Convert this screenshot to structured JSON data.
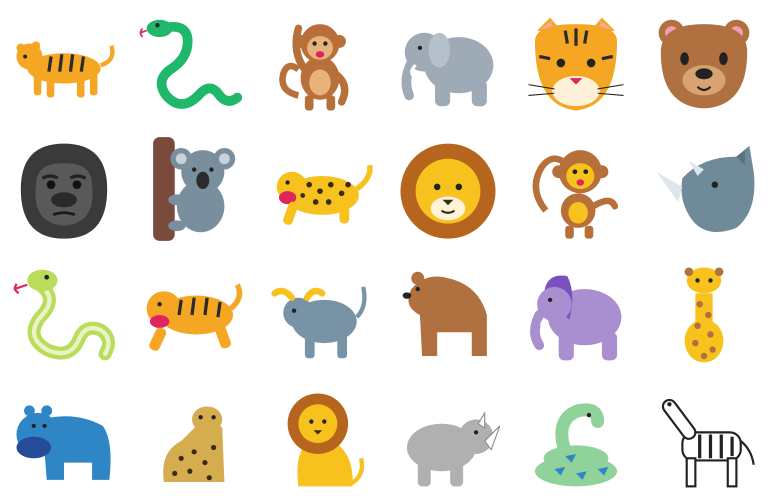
{
  "grid": {
    "rows": 4,
    "columns": 6,
    "cells": [
      {
        "icon": "tiger-walking-icon"
      },
      {
        "icon": "snake-icon"
      },
      {
        "icon": "monkey-icon"
      },
      {
        "icon": "elephant-icon"
      },
      {
        "icon": "tiger-face-icon"
      },
      {
        "icon": "bear-face-icon"
      },
      {
        "icon": "gorilla-icon"
      },
      {
        "icon": "koala-icon"
      },
      {
        "icon": "leopard-icon"
      },
      {
        "icon": "lion-face-icon"
      },
      {
        "icon": "monkey-icon"
      },
      {
        "icon": "rhinoceros-head-icon"
      },
      {
        "icon": "snake-icon"
      },
      {
        "icon": "tiger-leaping-icon"
      },
      {
        "icon": "water-buffalo-icon"
      },
      {
        "icon": "bear-icon"
      },
      {
        "icon": "elephant-icon"
      },
      {
        "icon": "giraffe-icon"
      },
      {
        "icon": "hippopotamus-icon"
      },
      {
        "icon": "leopard-sitting-icon"
      },
      {
        "icon": "lion-sitting-icon"
      },
      {
        "icon": "rhinoceros-icon"
      },
      {
        "icon": "snake-coiled-icon"
      },
      {
        "icon": "zebra-icon"
      }
    ]
  },
  "colors": {
    "tiger": "#f5a623",
    "snake_green": "#1fb86a",
    "monkey": "#b8703a",
    "elephant_grey": "#9eaab6",
    "bear_brown": "#b07040",
    "gorilla": "#3a3a3a",
    "koala": "#7a8f9e",
    "leopard": "#f7c21d",
    "lion_mane": "#b5651d",
    "rhino": "#6f8a99",
    "light_snake": "#b9dc5b",
    "buffalo": "#7893a5",
    "elephant_purple": "#a98ed0",
    "giraffe": "#f7c21d",
    "hippo": "#2f86c7",
    "zebra": "#222222"
  }
}
